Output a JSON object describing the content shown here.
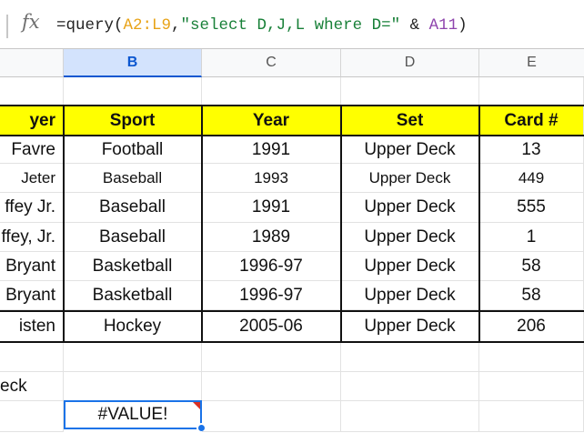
{
  "formula_bar": {
    "fx_label": "fx",
    "formula_parts": [
      {
        "text": "=query(",
        "color": "#222222"
      },
      {
        "text": "A2:L9",
        "color": "#e8a317"
      },
      {
        "text": ",",
        "color": "#222222"
      },
      {
        "text": "\"select D,J,L where D=\"",
        "color": "#188038"
      },
      {
        "text": " & ",
        "color": "#222222"
      },
      {
        "text": "A11",
        "color": "#8e44ad"
      },
      {
        "text": ")",
        "color": "#222222"
      }
    ]
  },
  "columns": [
    "B",
    "C",
    "D",
    "E"
  ],
  "selected_column": "B",
  "table": {
    "headers": [
      "yer",
      "Sport",
      "Year",
      "Set",
      "Card #"
    ],
    "rows": [
      [
        "Favre",
        "Football",
        "1991",
        "Upper Deck",
        "13"
      ],
      [
        "Jeter",
        "Baseball",
        "1993",
        "Upper Deck",
        "449"
      ],
      [
        "ffey Jr.",
        "Baseball",
        "1991",
        "Upper Deck",
        "555"
      ],
      [
        "ffey, Jr.",
        "Baseball",
        "1989",
        "Upper Deck",
        "1"
      ],
      [
        "Bryant",
        "Basketball",
        "1996-97",
        "Upper Deck",
        "58"
      ],
      [
        "Bryant",
        "Basketball",
        "1996-97",
        "Upper Deck",
        "58"
      ],
      [
        "isten",
        "Hockey",
        "2005-06",
        "Upper Deck",
        "206"
      ]
    ]
  },
  "below": {
    "a11_text": "eck",
    "b12_value": "#VALUE!"
  },
  "colors": {
    "header_fill": "#ffff00",
    "selection": "#1a73e8",
    "error_marker": "#d93025"
  }
}
